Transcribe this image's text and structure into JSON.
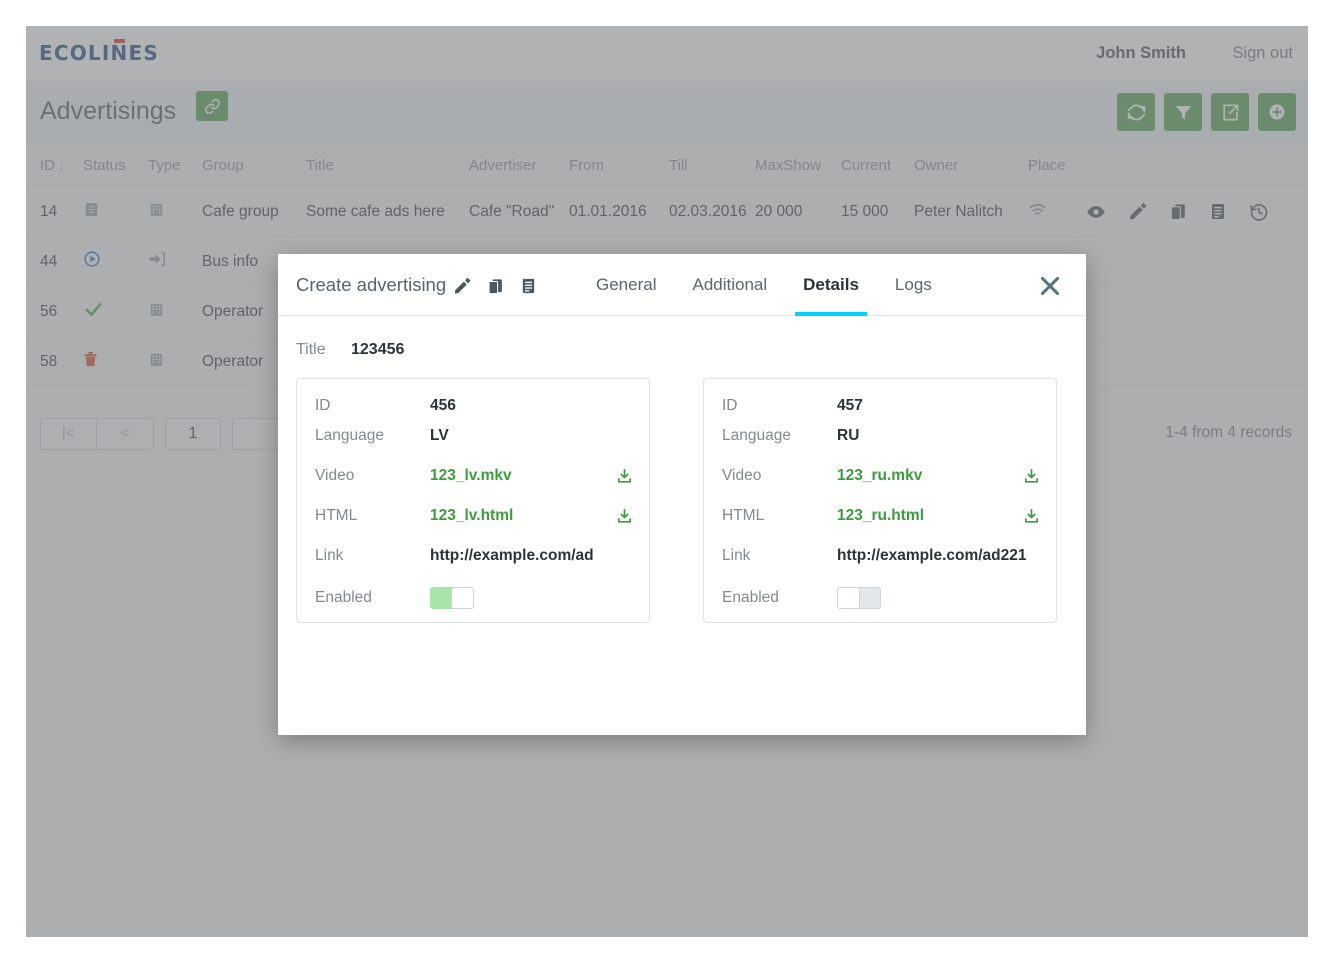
{
  "topbar": {
    "logo_text": "ECOLINES",
    "user_name": "John Smith",
    "sign_out_label": "Sign out"
  },
  "titlebar": {
    "page_title": "Advertisings",
    "link_button_icon": "link-icon",
    "toolbar": [
      {
        "name": "refresh-button",
        "icon": "refresh-icon",
        "color": "#489b48"
      },
      {
        "name": "filter-button",
        "icon": "filter-icon",
        "color": "#489b48"
      },
      {
        "name": "export-button",
        "icon": "export-icon",
        "color": "#489b48"
      },
      {
        "name": "add-button",
        "icon": "plus-circle-icon",
        "color": "#489b48"
      }
    ]
  },
  "table": {
    "sort_column": "ID",
    "sort_direction": "desc",
    "headers": {
      "id": "ID",
      "status": "Status",
      "type": "Type",
      "group": "Group",
      "title": "Title",
      "advertiser": "Advertiser",
      "from": "From",
      "till": "Till",
      "maxshow": "MaxShow",
      "current": "Current",
      "owner": "Owner",
      "place": "Place"
    },
    "rows": [
      {
        "id": "14",
        "status_icon": "draft-list-icon",
        "status_color": "#8e969c",
        "type_icon": "building-icon",
        "group": "Cafe group",
        "title": "Some cafe ads here",
        "advertiser": "Cafe \"Road\"",
        "from": "01.01.2016",
        "till": "02.03.2016",
        "maxshow": "20 000",
        "current": "15 000",
        "owner": "Peter Nalitch",
        "place_icon": "wifi-icon"
      },
      {
        "id": "44",
        "status_icon": "play-circle-icon",
        "status_color": "#1565c0",
        "type_icon": "sign-in-icon",
        "group": "Bus info",
        "title": "",
        "advertiser": "",
        "from": "",
        "till": "",
        "maxshow": "",
        "current": "",
        "owner": "",
        "place_icon": ""
      },
      {
        "id": "56",
        "status_icon": "check-icon",
        "status_color": "#3f9b3f",
        "type_icon": "building-icon",
        "group": "Operator",
        "title": "",
        "advertiser": "",
        "from": "",
        "till": "",
        "maxshow": "",
        "current": "",
        "owner": "",
        "place_icon": ""
      },
      {
        "id": "58",
        "status_icon": "trash-icon",
        "status_color": "#d9452b",
        "type_icon": "building-icon",
        "group": "Operator",
        "title": "",
        "advertiser": "",
        "from": "",
        "till": "",
        "maxshow": "",
        "current": "",
        "owner": "",
        "place_icon": ""
      }
    ],
    "row_actions": [
      "view-icon",
      "edit-icon",
      "copy-icon",
      "document-icon",
      "history-icon"
    ]
  },
  "pagination": {
    "first_label": "|<",
    "prev_label": "<",
    "page_value": "1",
    "records_info": "1-4 from 4 records"
  },
  "modal": {
    "title": "Create advertising",
    "header_icons": [
      "edit-icon",
      "copy-icon",
      "document-icon"
    ],
    "close_icon": "close-icon",
    "accent_color": "#00d3f7",
    "tabs": [
      {
        "label": "General",
        "active": false
      },
      {
        "label": "Additional",
        "active": false
      },
      {
        "label": "Details",
        "active": true
      },
      {
        "label": "Logs",
        "active": false
      }
    ],
    "details": {
      "title_label": "Title",
      "title_value": "123456",
      "labels": {
        "id": "ID",
        "language": "Language",
        "video": "Video",
        "html": "HTML",
        "link": "Link",
        "enabled": "Enabled"
      },
      "cards": [
        {
          "id": "456",
          "language": "LV",
          "video": "123_lv.mkv",
          "html": "123_lv.html",
          "link": "http://example.com/ad",
          "enabled": true,
          "download_icon": "download-icon"
        },
        {
          "id": "457",
          "language": "RU",
          "video": "123_ru.mkv",
          "html": "123_ru.html",
          "link": "http://example.com/ad221",
          "enabled": false,
          "download_icon": "download-icon"
        }
      ]
    }
  }
}
